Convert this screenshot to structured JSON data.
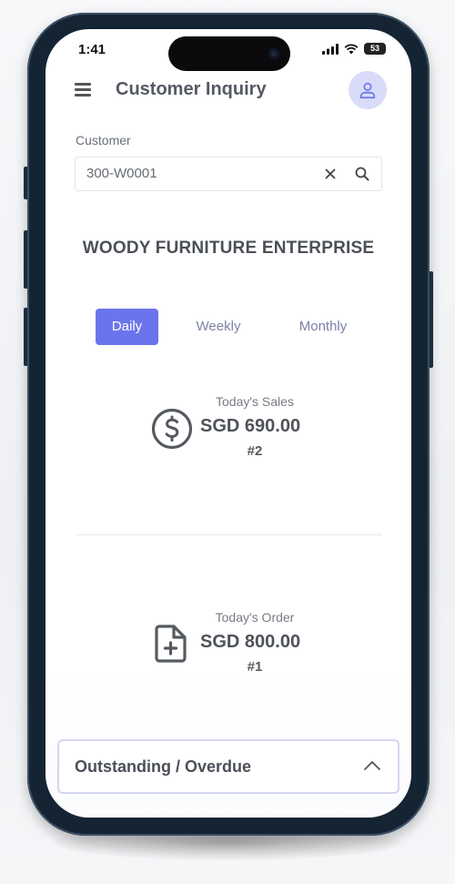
{
  "status_bar": {
    "time": "1:41",
    "battery": "53"
  },
  "header": {
    "title": "Customer Inquiry"
  },
  "customer": {
    "label": "Customer",
    "value": "300-W0001"
  },
  "company": {
    "name": "WOODY FURNITURE ENTERPRISE"
  },
  "tabs": [
    {
      "label": "Daily",
      "active": true
    },
    {
      "label": "Weekly",
      "active": false
    },
    {
      "label": "Monthly",
      "active": false
    }
  ],
  "sales": {
    "label": "Today's Sales",
    "value": "SGD 690.00",
    "count": "#2",
    "icon": "dollar-circle-icon"
  },
  "order": {
    "label": "Today's Order",
    "value": "SGD 800.00",
    "count": "#1",
    "icon": "file-plus-icon"
  },
  "accordion": {
    "title": "Outstanding / Overdue",
    "icon": "chevron-up-icon"
  },
  "colors": {
    "accent": "#6c74ec",
    "avatar_bg": "#d9dcf8",
    "phone_frame": "#152433"
  }
}
